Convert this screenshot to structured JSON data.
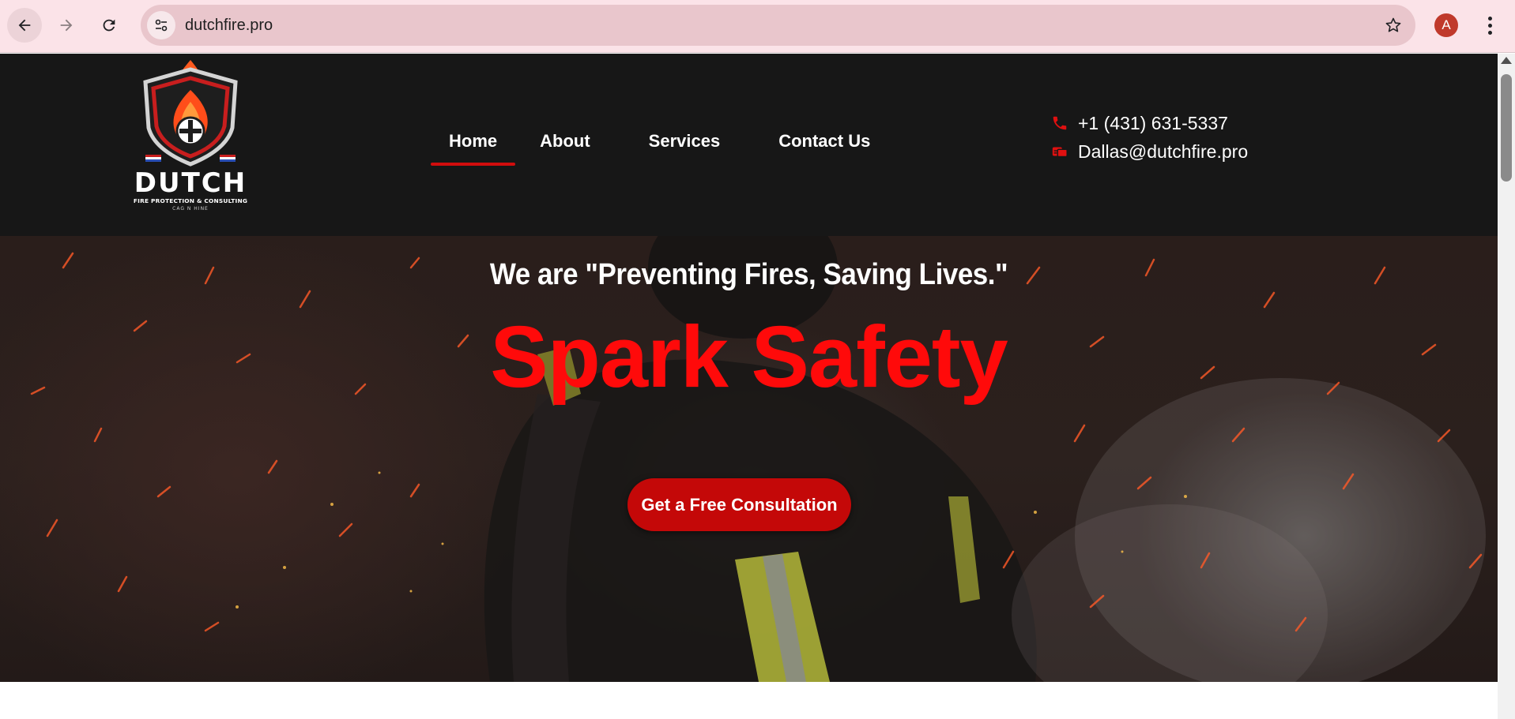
{
  "browser": {
    "url": "dutchfire.pro",
    "profile_initial": "A",
    "icons": [
      "back-arrow-icon",
      "forward-arrow-icon",
      "reload-icon",
      "site-info-icon",
      "star-icon",
      "kebab-menu-icon"
    ]
  },
  "header": {
    "logo": {
      "name": "DUTCH",
      "subtitle": "FIRE PROTECTION & CONSULTING",
      "tagline": "CAG N HINE"
    },
    "nav": [
      {
        "label": "Home",
        "active": true
      },
      {
        "label": "About",
        "active": false
      },
      {
        "label": "Services",
        "active": false
      },
      {
        "label": "Contact Us",
        "active": false
      }
    ],
    "contact": {
      "phone": "+1 (431) 631-5337",
      "email": "Dallas@dutchfire.pro"
    }
  },
  "hero": {
    "tagline": "We are \"Preventing Fires, Saving Lives.\"",
    "title": "Spark Safety",
    "cta_label": "Get a Free Consultation"
  },
  "colors": {
    "accent": "#ff0a0a",
    "button": "#c40808",
    "header_bg": "#171717",
    "chrome_bg": "#fbe3e8"
  }
}
